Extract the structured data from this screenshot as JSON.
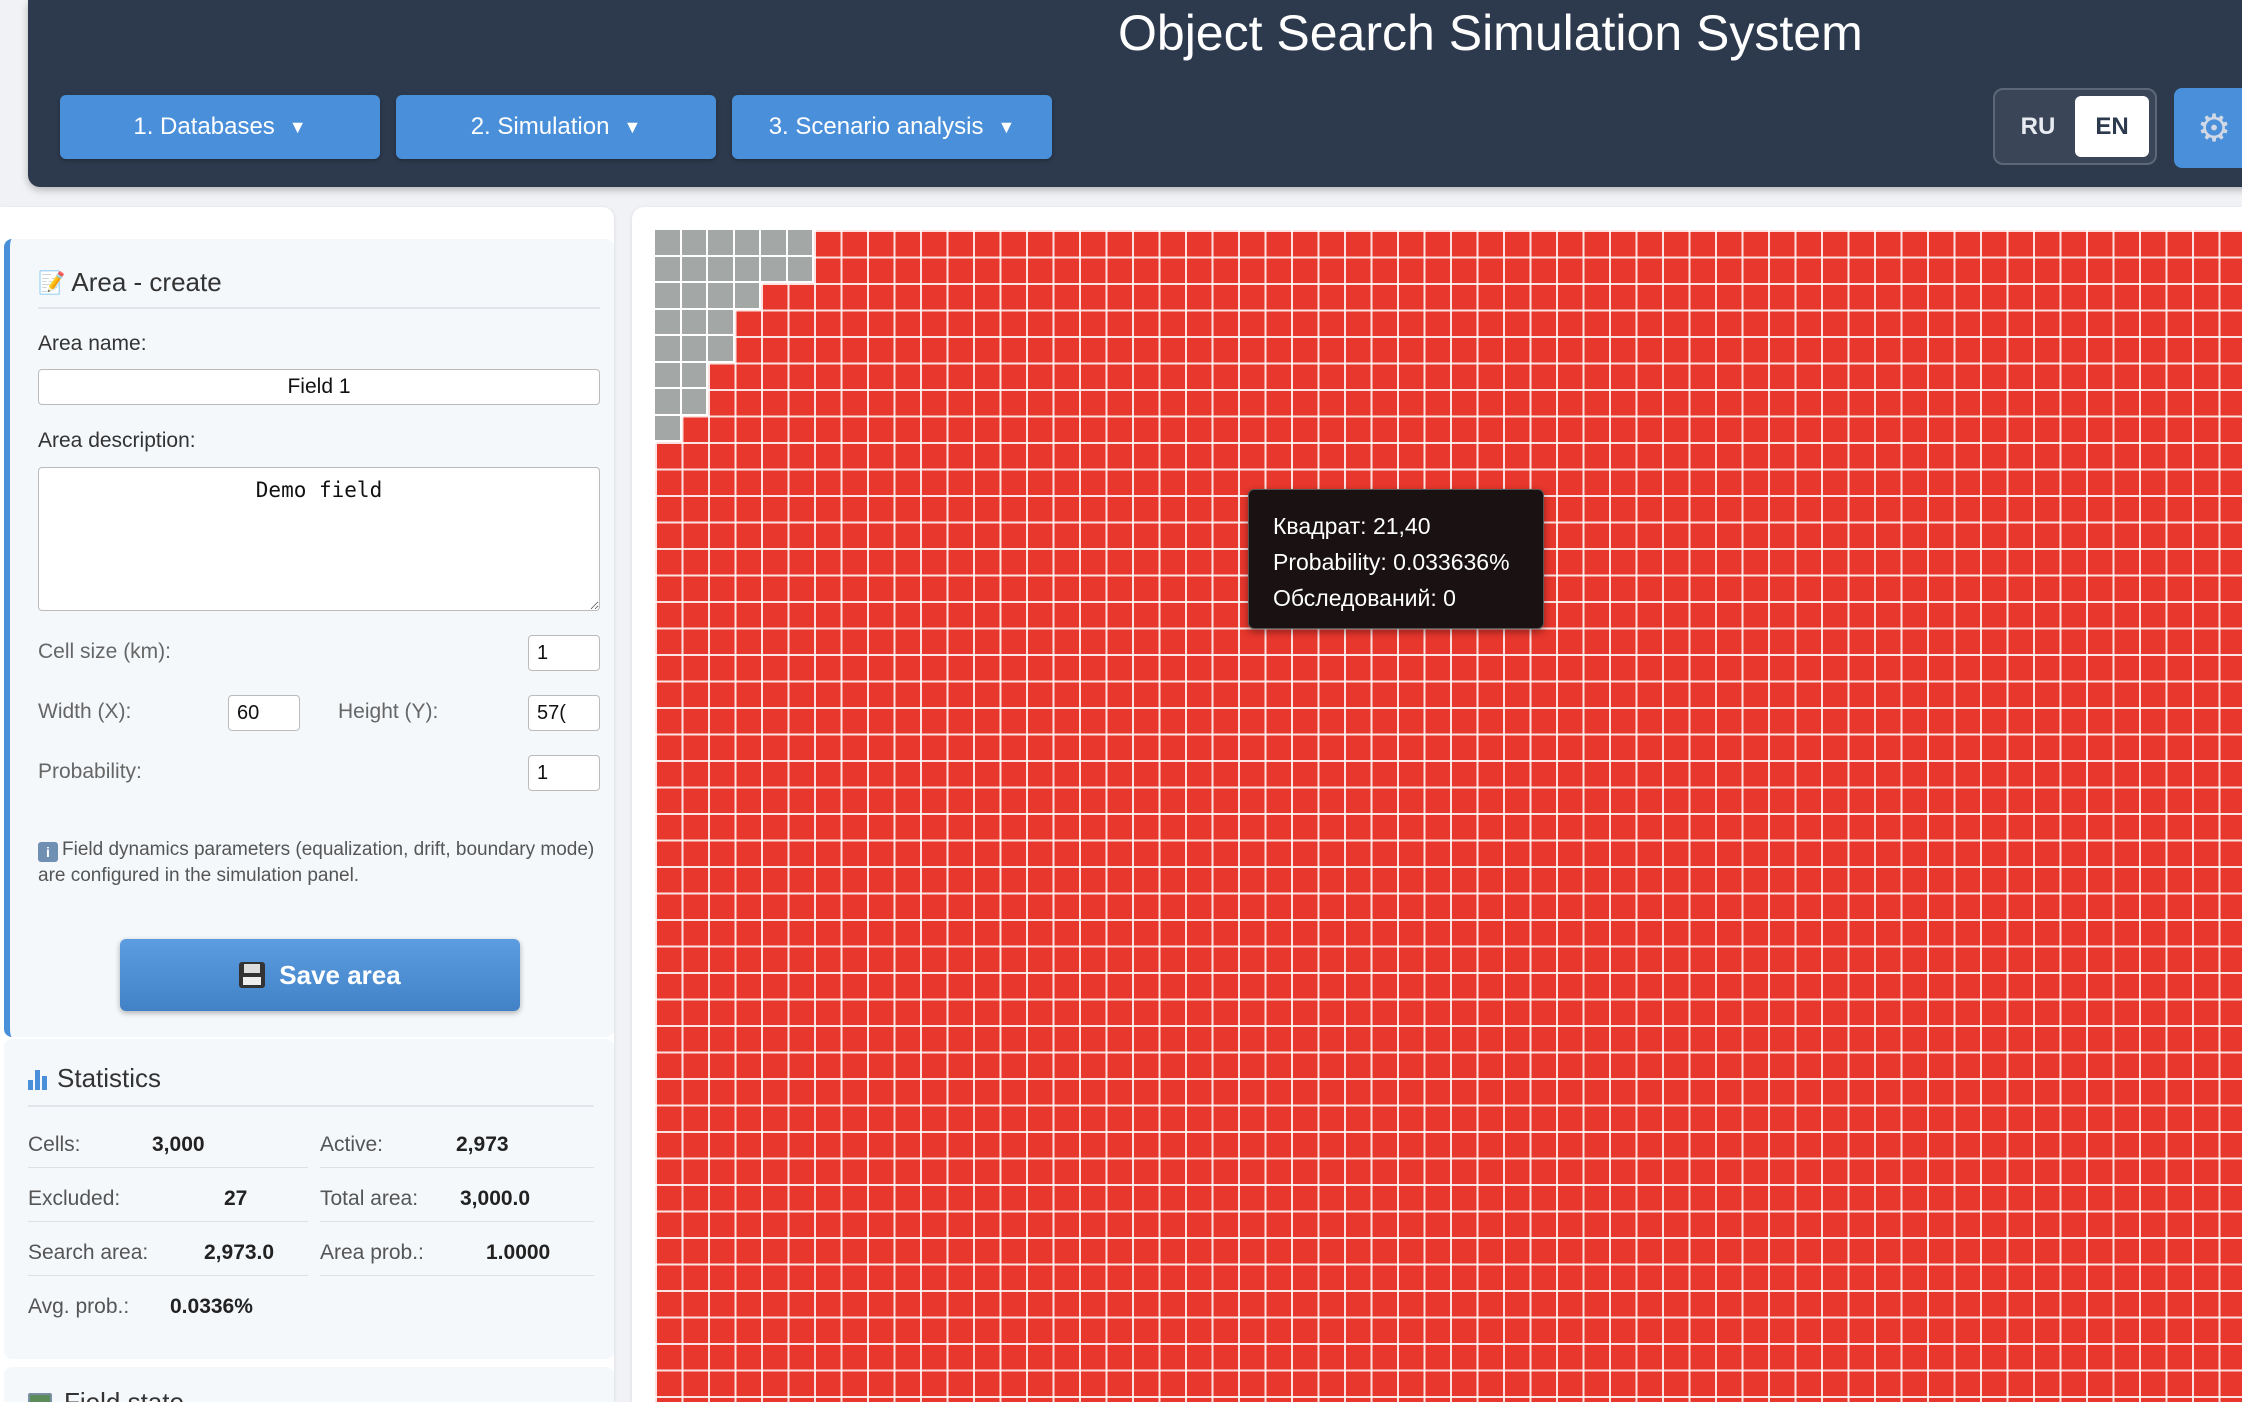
{
  "header": {
    "title": "Object Search Simulation System",
    "nav": [
      {
        "label": "1. Databases",
        "caret": "▼"
      },
      {
        "label": "2. Simulation",
        "caret": "▼"
      },
      {
        "label": "3. Scenario analysis",
        "caret": "▼"
      }
    ],
    "lang": {
      "ru": "RU",
      "en": "EN",
      "active": "EN"
    },
    "settings_icon": "gear-icon"
  },
  "area_create": {
    "title": "Area - create",
    "name_label": "Area name:",
    "name_value": "Field 1",
    "desc_label": "Area description:",
    "desc_value": "Demo field",
    "cell_size_label": "Cell size (km):",
    "cell_size_value": "1",
    "width_label": "Width (X):",
    "width_value": "60",
    "height_label": "Height (Y):",
    "height_value": "57(",
    "probability_label": "Probability:",
    "probability_value": "1",
    "info_text": "Field dynamics parameters (equalization, drift, boundary mode) are configured in the simulation panel.",
    "save_label": "Save area"
  },
  "statistics": {
    "title": "Statistics",
    "items": [
      {
        "label": "Cells:",
        "value": "3,000"
      },
      {
        "label": "Active:",
        "value": "2,973"
      },
      {
        "label": "Excluded:",
        "value": "27"
      },
      {
        "label": "Total area:",
        "value": "3,000.0"
      },
      {
        "label": "Search area:",
        "value": "2,973.0"
      },
      {
        "label": "Area prob.:",
        "value": "1.0000"
      },
      {
        "label": "Avg. prob.:",
        "value": "0.0336%"
      }
    ]
  },
  "field_state": {
    "title": "Field state"
  },
  "map": {
    "active_color": "#e8372c",
    "excluded_color": "#a3a8a6",
    "tooltip": {
      "line1": "Квадрат: 21,40",
      "line2": "Probability: 0.033636%",
      "line3": "Обследований: 0"
    }
  }
}
